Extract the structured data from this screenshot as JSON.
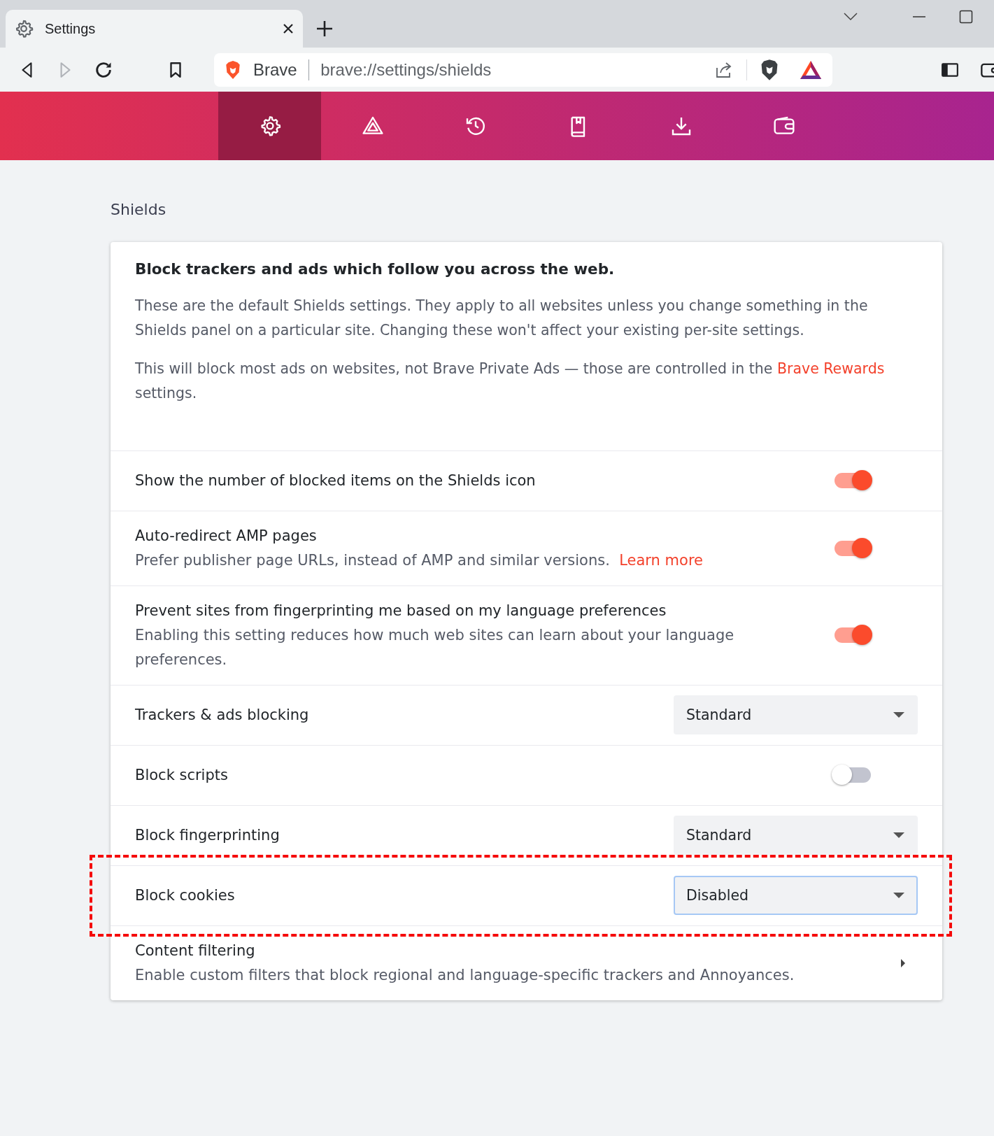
{
  "browser": {
    "tab": {
      "title": "Settings"
    },
    "address": {
      "site_label": "Brave",
      "url": "brave://settings/shields"
    }
  },
  "nav": [
    {
      "kind": "gear",
      "selected": true
    },
    {
      "kind": "triangle",
      "selected": false
    },
    {
      "kind": "history",
      "selected": false
    },
    {
      "kind": "book",
      "selected": false
    },
    {
      "kind": "download",
      "selected": false
    },
    {
      "kind": "wallet",
      "selected": false
    }
  ],
  "section_title": "Shields",
  "intro": {
    "heading": "Block trackers and ads which follow you across the web.",
    "paragraph": "These are the default Shields settings. They apply to all websites unless you change something in the Shields panel on a particular site. Changing these won't affect your existing per-site settings.",
    "note_before": "This will block most ads on websites, not Brave Private Ads — those are controlled in the",
    "note_link": "Brave Rewards",
    "note_after": "settings."
  },
  "settings": [
    {
      "kind": "toggle",
      "label": "Show the number of blocked items on the Shields icon",
      "on": true,
      "highlighted": false
    },
    {
      "kind": "toggle",
      "label": "Auto-redirect AMP pages",
      "description": "Prefer publisher page URLs, instead of AMP and similar versions.",
      "link": "Learn more",
      "on": true,
      "highlighted": false
    },
    {
      "kind": "toggle",
      "label": "Prevent sites from fingerprinting me based on my language preferences",
      "description": "Enabling this setting reduces how much web sites can learn about your language preferences.",
      "on": true,
      "highlighted": false
    },
    {
      "kind": "select",
      "label": "Trackers & ads blocking",
      "value": "Standard",
      "focused": false,
      "highlighted": false
    },
    {
      "kind": "toggle",
      "label": "Block scripts",
      "on": false,
      "highlighted": false
    },
    {
      "kind": "select",
      "label": "Block fingerprinting",
      "value": "Standard",
      "focused": false,
      "highlighted": false
    },
    {
      "kind": "select",
      "label": "Block cookies",
      "value": "Disabled",
      "focused": true,
      "highlighted": true
    },
    {
      "kind": "link",
      "label": "Content filtering",
      "description": "Enable custom filters that block regional and language-specific trackers and Annoyances.",
      "highlighted": false
    }
  ]
}
